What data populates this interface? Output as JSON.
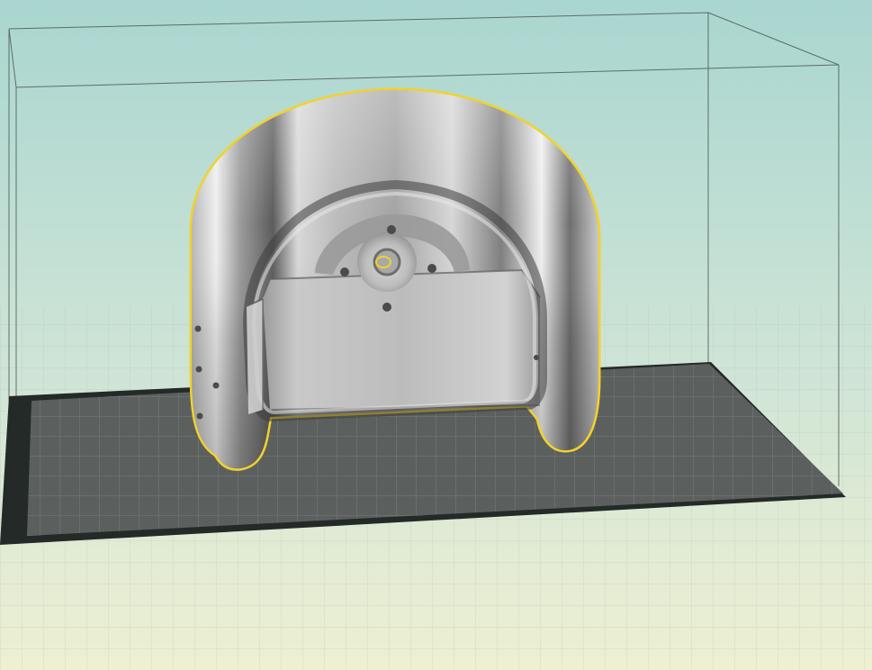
{
  "app": {
    "view": "3d-viewport"
  },
  "viewport": {
    "background_top": "#a9d6d0",
    "background_bottom": "#eef0d2",
    "floor_grid_color": "#9fb7ae",
    "bed_border_color": "#232a28",
    "bed_color": "#5b605e",
    "bed_grid_color": "#7b817f",
    "build_volume_line_color": "#4d5a57"
  },
  "model": {
    "selected": true,
    "outline_color": "#f2d22a",
    "shading": "grayscale-banded"
  }
}
